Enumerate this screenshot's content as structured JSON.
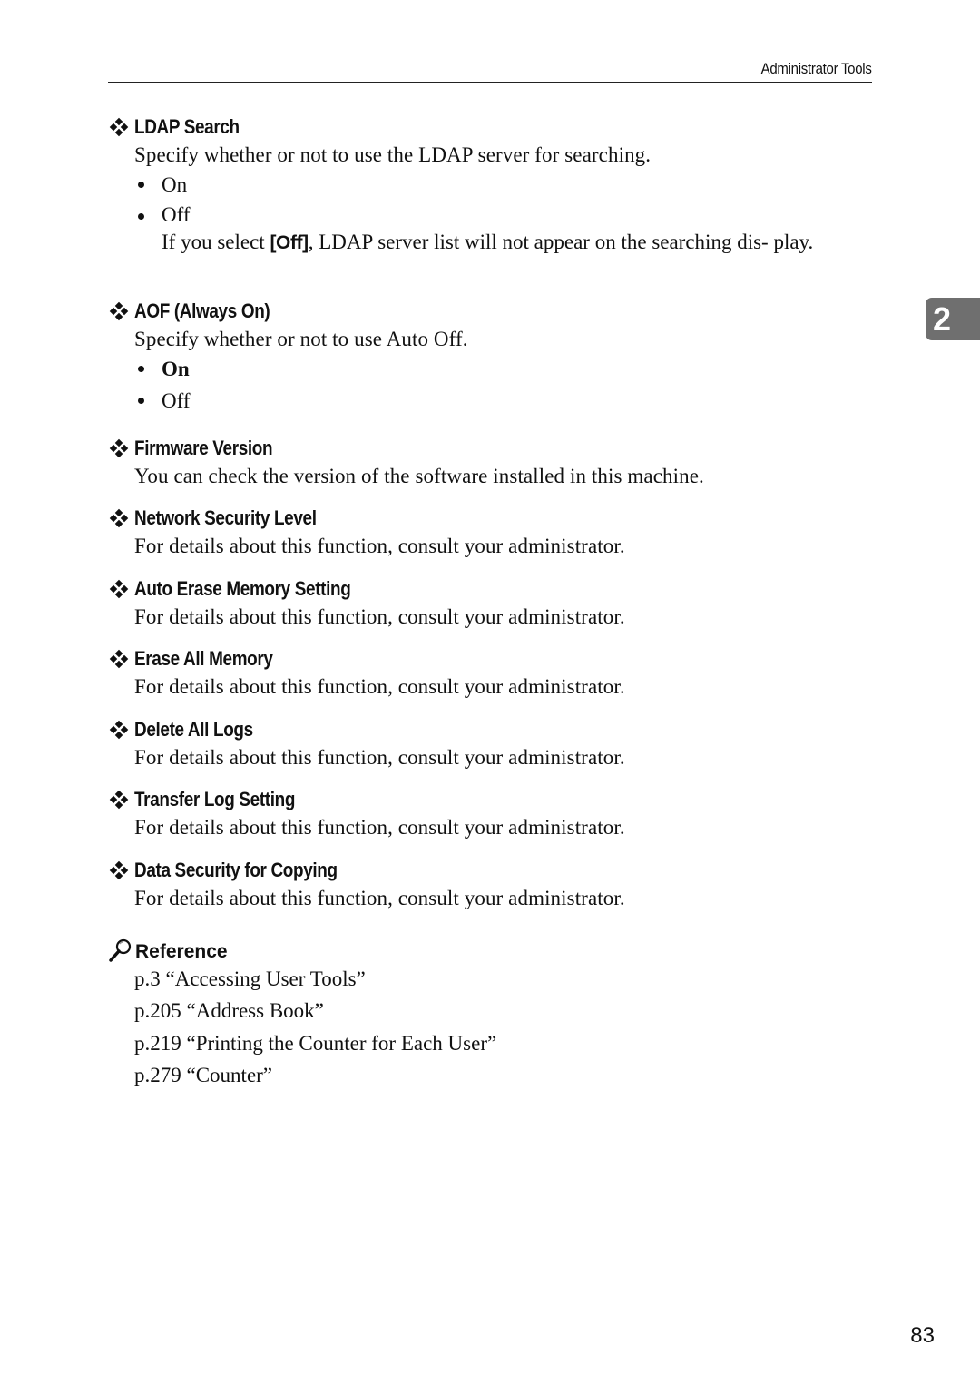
{
  "header": {
    "running_title": "Administrator Tools"
  },
  "chapter_tab": "2",
  "page_number": "83",
  "sections": [
    {
      "title": "LDAP Search",
      "description": "Specify whether or not to use the LDAP server for searching.",
      "options": [
        {
          "label": "On",
          "default": false
        },
        {
          "label": "Off",
          "default": false
        }
      ],
      "note_prefix": "If you select ",
      "note_key": "[Off]",
      "note_suffix": ", LDAP server list will not appear on the searching dis- play."
    },
    {
      "title": "AOF (Always On)",
      "description": "Specify whether or not to use Auto Off.",
      "options": [
        {
          "label": "On",
          "default": true
        },
        {
          "label": "Off",
          "default": false
        }
      ]
    },
    {
      "title": "Firmware Version",
      "description": "You can check the version of the software installed in this machine."
    },
    {
      "title": "Network Security Level",
      "description": "For details about this function, consult your administrator."
    },
    {
      "title": "Auto Erase Memory Setting",
      "description": "For details about this function, consult your administrator."
    },
    {
      "title": "Erase All Memory",
      "description": "For details about this function, consult your administrator."
    },
    {
      "title": "Delete All Logs",
      "description": "For details about this function, consult your administrator."
    },
    {
      "title": "Transfer Log Setting",
      "description": "For details about this function, consult your administrator."
    },
    {
      "title": "Data Security for Copying",
      "description": "For details about this function, consult your administrator."
    }
  ],
  "reference": {
    "icon": "magnifier-icon",
    "title": "Reference",
    "items": [
      "p.3 “Accessing User Tools”",
      "p.205 “Address Book”",
      "p.219 “Printing the Counter for Each User”",
      "p.279 “Counter”"
    ]
  }
}
